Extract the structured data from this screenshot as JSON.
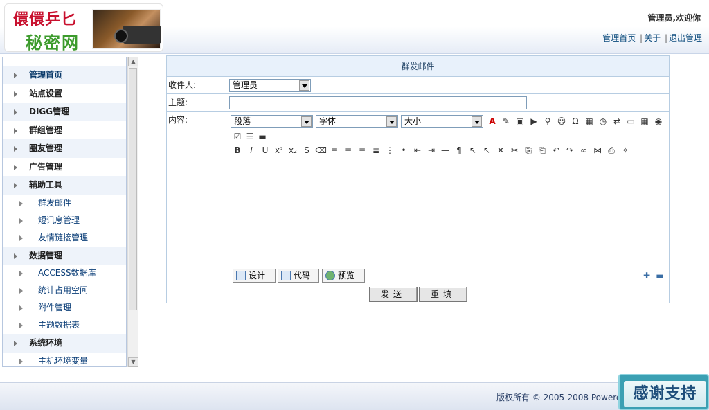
{
  "header": {
    "logo_line1": "儇儇乒匕",
    "logo_line2": "秘密网",
    "welcome": "管理员,欢迎你",
    "links": [
      "管理首页",
      "关于",
      "退出管理"
    ],
    "separator": "|"
  },
  "sidebar": {
    "items": [
      {
        "label": "管理首页",
        "type": "main"
      },
      {
        "label": "站点设置",
        "type": "main"
      },
      {
        "label": "DIGG管理",
        "type": "main"
      },
      {
        "label": "群组管理",
        "type": "main"
      },
      {
        "label": "圈友管理",
        "type": "main"
      },
      {
        "label": "广告管理",
        "type": "main"
      },
      {
        "label": "辅助工具",
        "type": "main"
      },
      {
        "label": "群发邮件",
        "type": "sub"
      },
      {
        "label": "短讯息管理",
        "type": "sub"
      },
      {
        "label": "友情链接管理",
        "type": "sub"
      },
      {
        "label": "数据管理",
        "type": "main"
      },
      {
        "label": "ACCESS数据库",
        "type": "sub"
      },
      {
        "label": "统计占用空间",
        "type": "sub"
      },
      {
        "label": "附件管理",
        "type": "sub"
      },
      {
        "label": "主题数据表",
        "type": "sub"
      },
      {
        "label": "系统环境",
        "type": "main"
      },
      {
        "label": "主机环境变量",
        "type": "sub"
      }
    ]
  },
  "form": {
    "title": "群发邮件",
    "recipient_label": "收件人:",
    "recipient_value": "管理员",
    "subject_label": "主题:",
    "subject_value": "",
    "content_label": "内容:",
    "paragraph_select": "段落",
    "font_select": "字体",
    "size_select": "大小",
    "mode_design": "设计",
    "mode_code": "代码",
    "mode_preview": "预览",
    "send_button": "发送",
    "reset_button": "重填"
  },
  "toolbar_icons_row1": [
    "font-color-icon",
    "highlight-color-icon",
    "image-icon",
    "media-icon",
    "find-icon",
    "emoticon-icon",
    "special-char-icon",
    "date-icon",
    "time-icon",
    "replace-icon",
    "form-field-icon",
    "table-icon",
    "radio-icon"
  ],
  "toolbar_icons_row2": [
    "checkbox-icon",
    "list-field-icon",
    "button-field-icon"
  ],
  "toolbar_icons_row3": [
    "bold-icon",
    "italic-icon",
    "underline-icon",
    "superscript-icon",
    "subscript-icon",
    "strikethrough-icon",
    "eraser-icon",
    "align-left-icon",
    "align-center-icon",
    "align-right-icon",
    "justify-icon",
    "ordered-list-icon",
    "unordered-list-icon",
    "outdent-icon",
    "indent-icon",
    "horizontal-rule-icon",
    "paragraph-icon",
    "cursor-add-icon",
    "cursor-icon",
    "delete-icon",
    "cut-icon",
    "copy-icon",
    "paste-icon",
    "undo-icon",
    "redo-icon",
    "link-icon",
    "unlink-icon",
    "print-icon",
    "clean-icon"
  ],
  "footer": {
    "copyright": "版权所有 © 2005-2008 Powere",
    "thanks": "感谢支持"
  }
}
